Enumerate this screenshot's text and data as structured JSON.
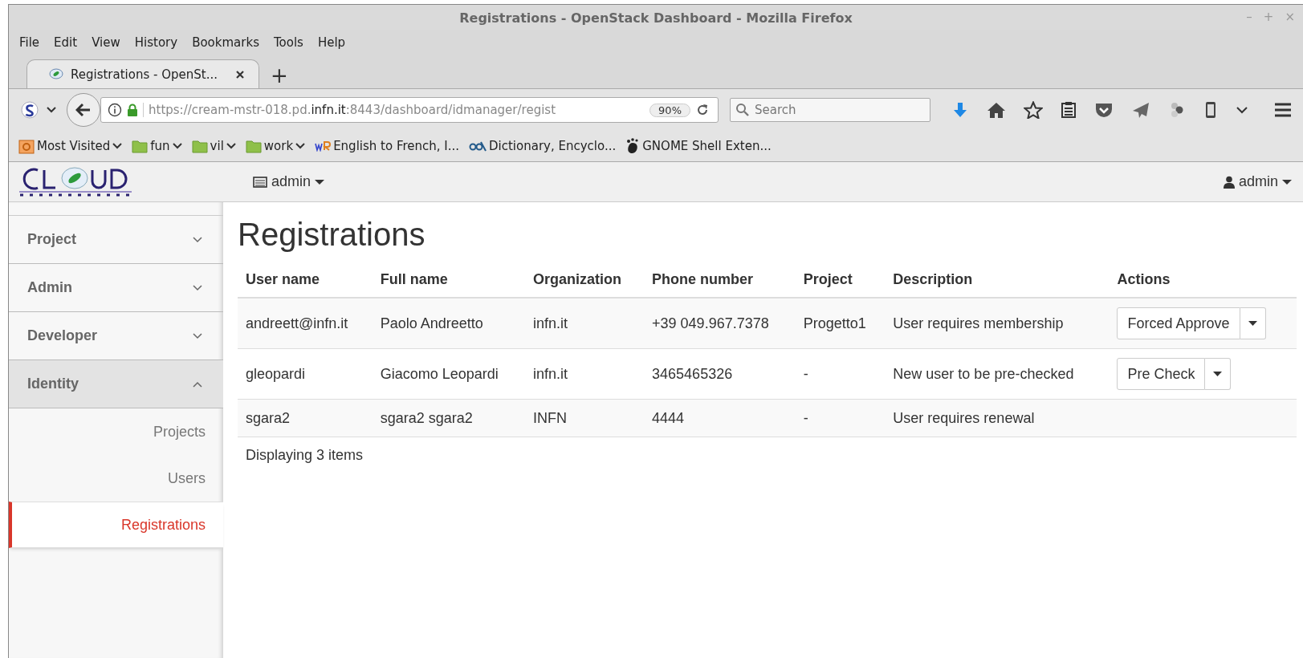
{
  "window": {
    "title": "Registrations - OpenStack Dashboard - Mozilla Firefox",
    "controls": [
      "–",
      "+",
      "×"
    ]
  },
  "menu": [
    "File",
    "Edit",
    "View",
    "History",
    "Bookmarks",
    "Tools",
    "Help"
  ],
  "tabs": [
    {
      "label": "Registrations - OpenSt...",
      "selected": true
    }
  ],
  "new_tab": "+",
  "navbar": {
    "url": {
      "prefix": "https://cream-mstr-018.pd.",
      "host": "infn.it",
      "suffix": ":8443/dashboard/idmanager/regist"
    },
    "zoom": "90%",
    "search": {
      "placeholder": "Search"
    }
  },
  "bookmarks": [
    {
      "kind": "menu",
      "label": "Most Visited"
    },
    {
      "kind": "folder",
      "label": "fun"
    },
    {
      "kind": "folder",
      "label": "vil"
    },
    {
      "kind": "folder",
      "label": "work"
    },
    {
      "kind": "wr",
      "label": "English to French, I..."
    },
    {
      "kind": "dict",
      "label": "Dictionary, Encyclo..."
    },
    {
      "kind": "gnome",
      "label": "GNOME Shell Exten..."
    }
  ],
  "header": {
    "project_menu": "admin",
    "user_menu": "admin"
  },
  "sidebar": {
    "items": [
      {
        "label": "Project",
        "expanded": false
      },
      {
        "label": "Admin",
        "expanded": false
      },
      {
        "label": "Developer",
        "expanded": false
      },
      {
        "label": "Identity",
        "expanded": true,
        "children": [
          {
            "label": "Projects",
            "selected": false
          },
          {
            "label": "Users",
            "selected": false
          },
          {
            "label": "Registrations",
            "selected": true
          }
        ]
      }
    ]
  },
  "page_title": "Registrations",
  "table": {
    "columns": [
      "User name",
      "Full name",
      "Organization",
      "Phone number",
      "Project",
      "Description",
      "Actions"
    ],
    "rows": [
      {
        "cells": [
          "andreett@infn.it",
          "Paolo Andreetto",
          "infn.it",
          "+39 049.967.7378",
          "Progetto1",
          "User requires membership"
        ],
        "action": "Forced Approve"
      },
      {
        "cells": [
          "gleopardi",
          "Giacomo Leopardi",
          "infn.it",
          "3465465326",
          "-",
          "New user to be pre-checked"
        ],
        "action": "Pre Check"
      },
      {
        "cells": [
          "sgara2",
          "sgara2 sgara2",
          "INFN",
          "4444",
          "-",
          "User requires renewal"
        ]
      }
    ],
    "footer": "Displaying 3 items"
  }
}
